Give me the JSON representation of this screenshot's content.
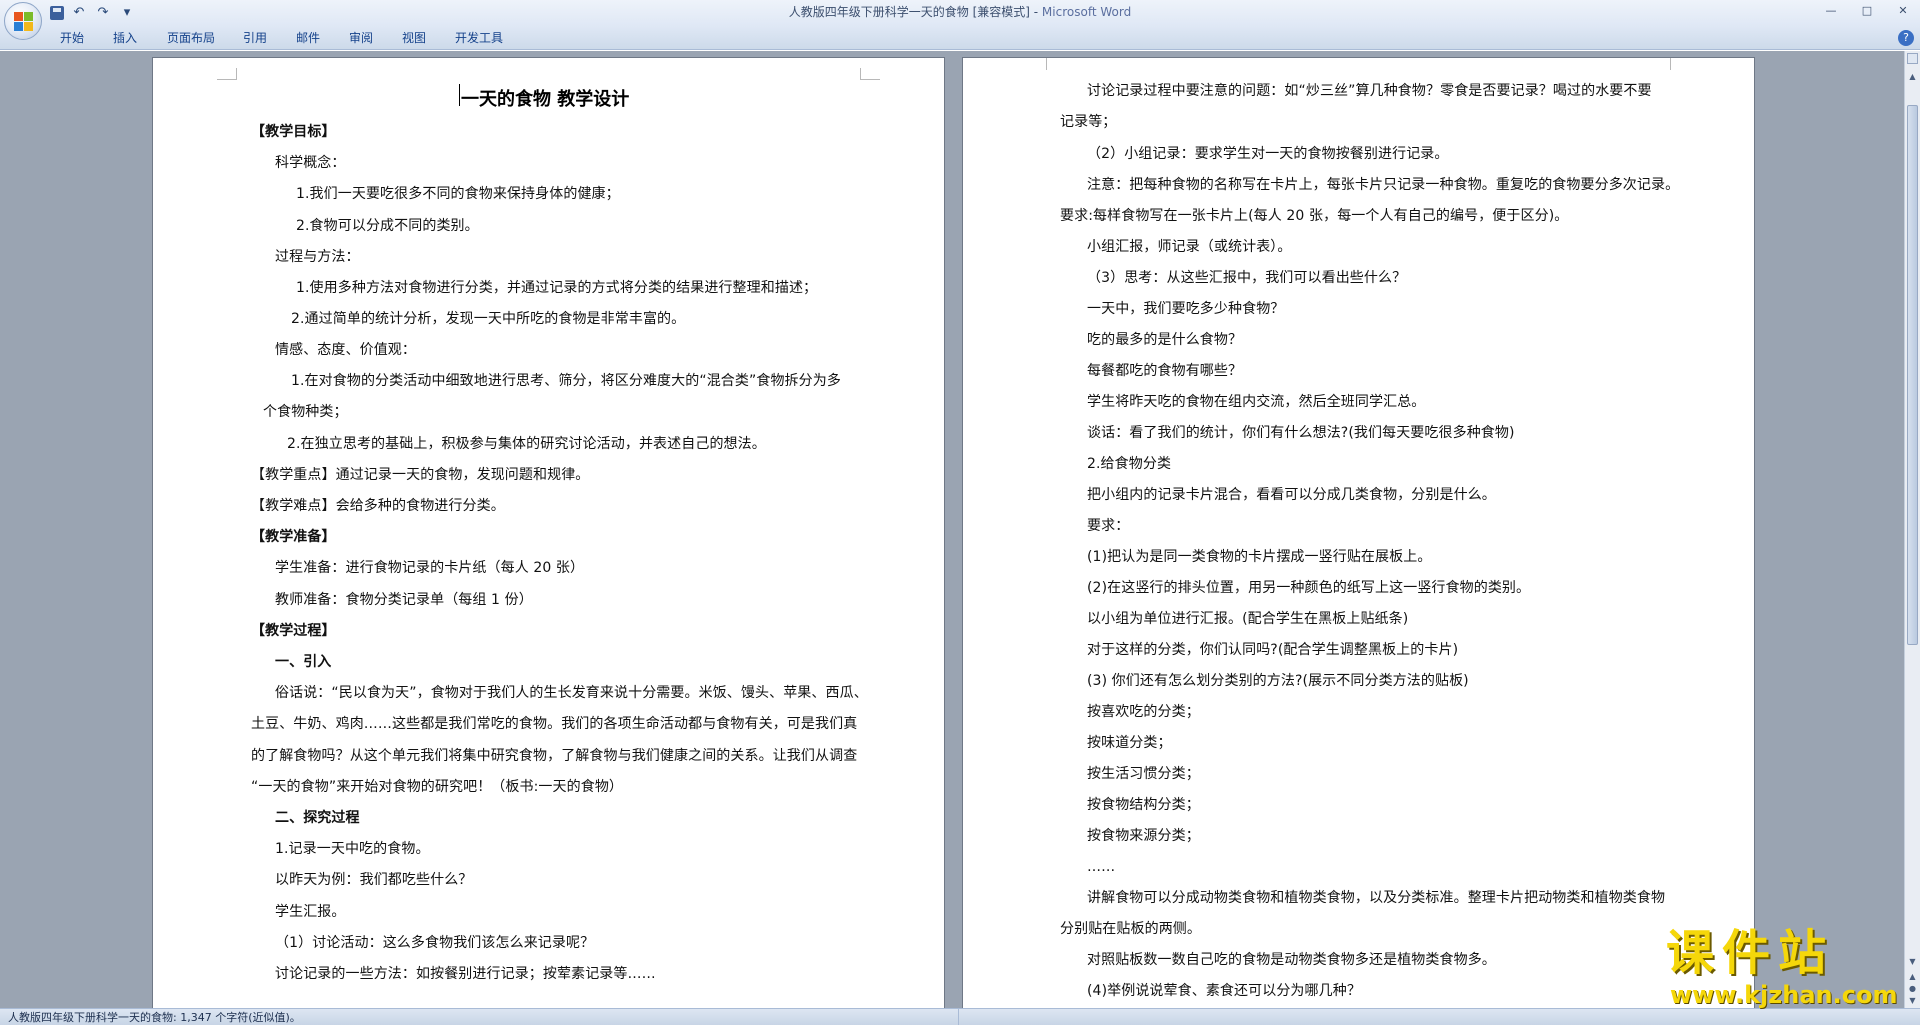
{
  "window": {
    "title": "人教版四年级下册科学一天的食物 [兼容模式] - ",
    "app_name": "Microsoft Word",
    "quick_access": {
      "save_icon": "save-icon",
      "undo": "↶",
      "redo": "↷",
      "customize": "▾"
    },
    "controls": {
      "minimize": "—",
      "maximize": "□",
      "close": "✕"
    }
  },
  "ribbon": {
    "tabs": [
      "开始",
      "插入",
      "页面布局",
      "引用",
      "邮件",
      "审阅",
      "视图",
      "开发工具"
    ],
    "help": "?"
  },
  "document": {
    "title": "一天的食物  教学设计",
    "page1": [
      "【教学目标】",
      "科学概念：",
      "1.我们一天要吃很多不同的食物来保持身体的健康；",
      "2.食物可以分成不同的类别。",
      "过程与方法：",
      "1.使用多种方法对食物进行分类，并通过记录的方式将分类的结果进行整理和描述；",
      "2.通过简单的统计分析，发现一天中所吃的食物是非常丰富的。",
      "情感、态度、价值观：",
      "1.在对食物的分类活动中细致地进行思考、筛分，将区分难度大的“混合类”食物拆分为多",
      "个食物种类；",
      "2.在独立思考的基础上，积极参与集体的研究讨论活动，并表述自己的想法。",
      "【教学重点】通过记录一天的食物，发现问题和规律。",
      "【教学难点】会给多种的食物进行分类。",
      "【教学准备】",
      "学生准备：进行食物记录的卡片纸（每人 20 张）",
      "教师准备：食物分类记录单（每组 1 份）",
      "【教学过程】",
      "一、引入",
      "俗话说：“民以食为天”，食物对于我们人的生长发育来说十分需要。米饭、馒头、苹果、西瓜、",
      "土豆、牛奶、鸡肉……这些都是我们常吃的食物。我们的各项生命活动都与食物有关，可是我们真",
      "的了解食物吗？从这个单元我们将集中研究食物，了解食物与我们健康之间的关系。让我们从调查",
      "“一天的食物”来开始对食物的研究吧！（板书:一天的食物）",
      "二、探究过程",
      "1.记录一天中吃的食物。",
      "以昨天为例：我们都吃些什么？",
      "学生汇报。",
      "（1）讨论活动：这么多食物我们该怎么来记录呢？",
      "讨论记录的一些方法：如按餐别进行记录；按荤素记录等……"
    ],
    "page2": [
      "讨论记录过程中要注意的问题：如“炒三丝”算几种食物？零食是否要记录？喝过的水要不要",
      "记录等；",
      "（2）小组记录：要求学生对一天的食物按餐别进行记录。",
      "注意：把每种食物的名称写在卡片上，每张卡片只记录一种食物。重复吃的食物要分多次记录。",
      "要求:每样食物写在一张卡片上(每人 20 张，每一个人有自己的编号，便于区分)。",
      "小组汇报，师记录（或统计表）。",
      "（3）思考：从这些汇报中，我们可以看出些什么？",
      " 一天中，我们要吃多少种食物？",
      "吃的最多的是什么食物？",
      "每餐都吃的食物有哪些？",
      "学生将昨天吃的食物在组内交流，然后全班同学汇总。",
      "谈话：看了我们的统计，你们有什么想法?(我们每天要吃很多种食物)",
      "2.给食物分类",
      "把小组内的记录卡片混合，看看可以分成几类食物，分别是什么。",
      "要求：",
      "(1)把认为是同一类食物的卡片摆成一竖行贴在展板上。",
      "(2)在这竖行的排头位置，用另一种颜色的纸写上这一竖行食物的类别。",
      " 以小组为单位进行汇报。(配合学生在黑板上贴纸条)",
      " 对于这样的分类，你们认同吗?(配合学生调整黑板上的卡片)",
      "(3) 你们还有怎么划分类别的方法?(展示不同分类方法的贴板)",
      "按喜欢吃的分类；",
      "按味道分类；",
      "按生活习惯分类；",
      "按食物结构分类；",
      "按食物来源分类；",
      "……",
      "讲解食物可以分成动物类食物和植物类食物，以及分类标准。整理卡片把动物类和植物类食物",
      "分别贴在贴板的两侧。",
      "对照贴板数一数自己吃的食物是动物类食物多还是植物类食物多。",
      "(4)举例说说荤食、素食还可以分为哪几种？"
    ]
  },
  "status_bar": {
    "text": "人教版四年级下册科学一天的食物: 1,347 个字符(近似值)。"
  },
  "watermark": {
    "cn": "课件站",
    "url": "www.kjzhan.com"
  }
}
